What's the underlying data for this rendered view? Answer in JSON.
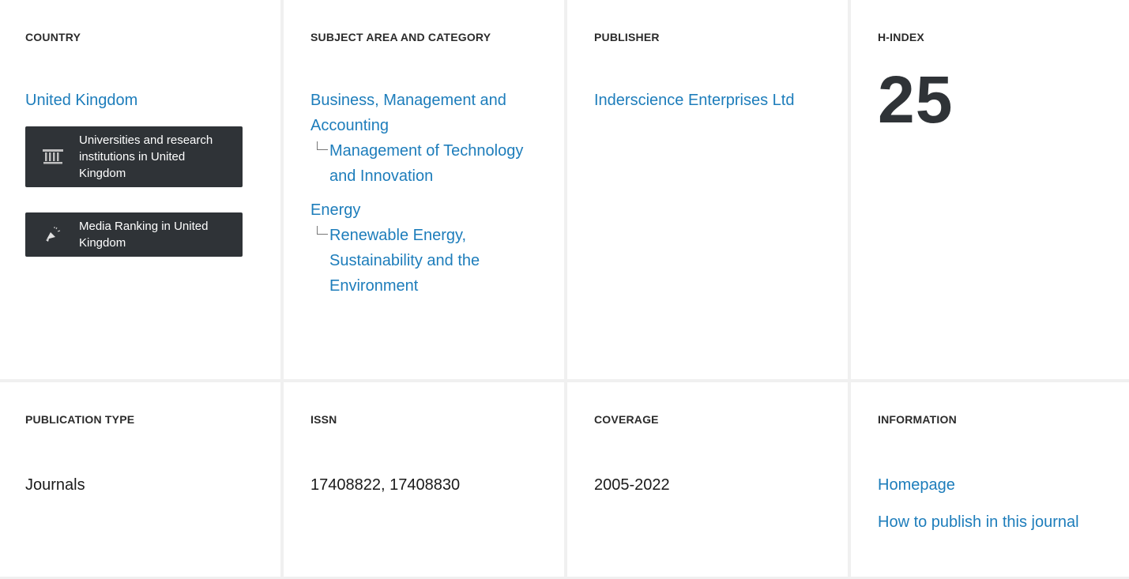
{
  "country": {
    "heading": "COUNTRY",
    "name": "United Kingdom",
    "buttons": [
      {
        "label": "Universities and research institutions in United Kingdom",
        "icon": "institution-icon"
      },
      {
        "label": "Media Ranking in United Kingdom",
        "icon": "megaphone-icon"
      }
    ]
  },
  "subject": {
    "heading": "SUBJECT AREA AND CATEGORY",
    "areas": [
      {
        "name": "Business, Management and Accounting",
        "category": "Management of Technology and Innovation"
      },
      {
        "name": "Energy",
        "category": "Renewable Energy, Sustainability and the Environment"
      }
    ]
  },
  "publisher": {
    "heading": "PUBLISHER",
    "name": "Inderscience Enterprises Ltd"
  },
  "hindex": {
    "heading": "H-INDEX",
    "value": "25"
  },
  "publication_type": {
    "heading": "PUBLICATION TYPE",
    "value": "Journals"
  },
  "issn": {
    "heading": "ISSN",
    "value": "17408822, 17408830"
  },
  "coverage": {
    "heading": "COVERAGE",
    "value": "2005-2022"
  },
  "information": {
    "heading": "INFORMATION",
    "links": [
      "Homepage",
      "How to publish in this journal"
    ]
  }
}
